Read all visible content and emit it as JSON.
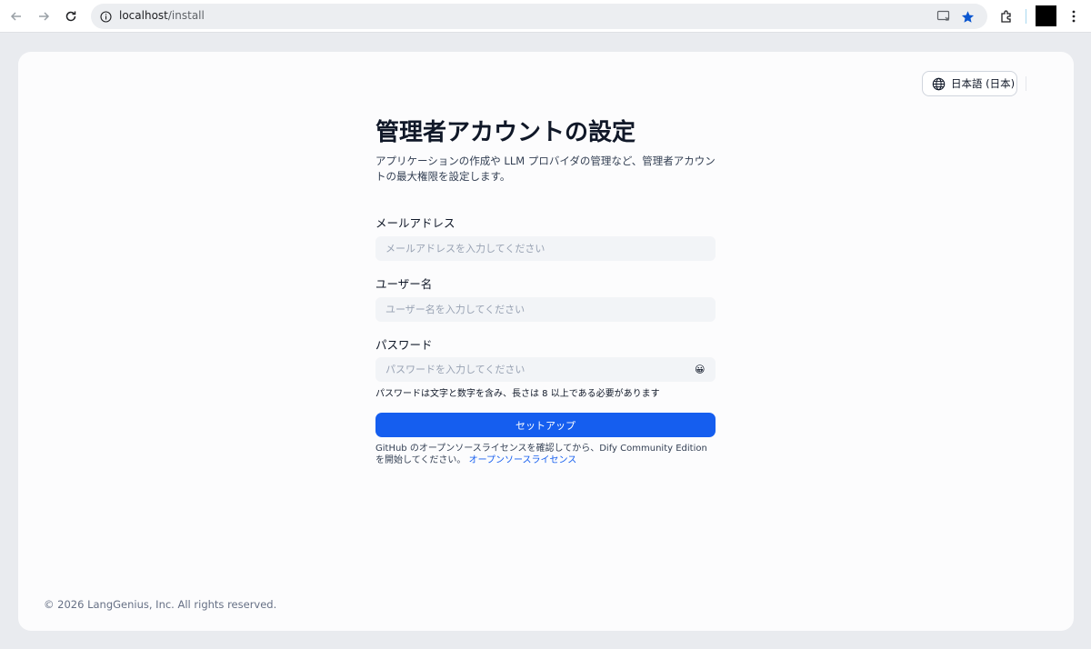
{
  "browser": {
    "url_host": "localhost",
    "url_path": "/install",
    "icons": [
      "back-arrow-icon",
      "forward-arrow-icon",
      "reload-icon",
      "site-info-icon",
      "cast-icon",
      "star-icon",
      "extensions-icon",
      "kebab-menu-icon"
    ],
    "accent": "#1a73e8"
  },
  "header": {
    "language_label": "日本語 (日本)",
    "language_icon": "globe-icon"
  },
  "main": {
    "title": "管理者アカウントの設定",
    "description": "アプリケーションの作成や LLM プロバイダの管理など、管理者アカウントの最大権限を設定します。",
    "email": {
      "label": "メールアドレス",
      "placeholder": "メールアドレスを入力してください",
      "value": ""
    },
    "username": {
      "label": "ユーザー名",
      "placeholder": "ユーザー名を入力してください",
      "value": ""
    },
    "password": {
      "label": "パスワード",
      "placeholder": "パスワードを入力してください",
      "value": "",
      "toggle_icon": "😀",
      "hint": "パスワードは文字と数字を含み、長さは 8 以上である必要があります"
    },
    "submit_label": "セットアップ",
    "license_text": "GitHub のオープンソースライセンスを確認してから、Dify Community Edition を開始してください。",
    "license_link": "オープンソースライセンス"
  },
  "footer": {
    "copyright": "© 2026 LangGenius, Inc. All rights reserved."
  },
  "colors": {
    "primary": "#155eef",
    "page_bg": "#e9ebef",
    "card_bg": "#fcfcfd",
    "input_bg": "#f2f4f7"
  }
}
